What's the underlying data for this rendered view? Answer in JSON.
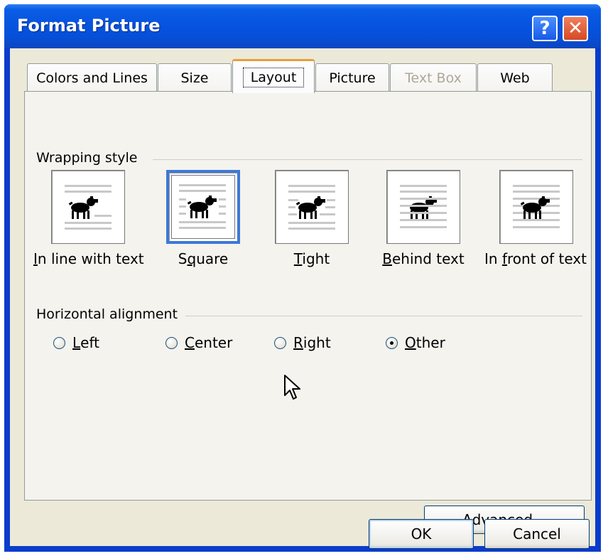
{
  "window": {
    "title": "Format Picture",
    "help_glyph": "?",
    "close_glyph": "✕",
    "accent_color": "#0a5ee6"
  },
  "tabs": [
    {
      "label": "Colors and Lines",
      "state": "normal"
    },
    {
      "label": "Size",
      "state": "normal"
    },
    {
      "label": "Layout",
      "state": "active"
    },
    {
      "label": "Picture",
      "state": "normal"
    },
    {
      "label": "Text Box",
      "state": "disabled"
    },
    {
      "label": "Web",
      "state": "normal"
    }
  ],
  "wrapping": {
    "group_label": "Wrapping style",
    "options": [
      {
        "label_pre": "",
        "label_u": "I",
        "label_post": "n line with text",
        "icon": "inline-wrap-icon"
      },
      {
        "label_pre": "S",
        "label_u": "q",
        "label_post": "uare",
        "icon": "square-wrap-icon",
        "selected": true
      },
      {
        "label_pre": "",
        "label_u": "T",
        "label_post": "ight",
        "icon": "tight-wrap-icon"
      },
      {
        "label_pre": "",
        "label_u": "B",
        "label_post": "ehind text",
        "icon": "behind-text-icon"
      },
      {
        "label_pre": "In ",
        "label_u": "f",
        "label_post": "ront of text",
        "icon": "in-front-icon"
      }
    ]
  },
  "alignment": {
    "group_label": "Horizontal alignment",
    "options": [
      {
        "label_u": "L",
        "label_post": "eft",
        "checked": false
      },
      {
        "label_u": "C",
        "label_post": "enter",
        "checked": false
      },
      {
        "label_u": "R",
        "label_post": "ight",
        "checked": false
      },
      {
        "label_u": "O",
        "label_post": "ther",
        "checked": true
      }
    ]
  },
  "buttons": {
    "advanced_u": "A",
    "advanced_post": "dvanced...",
    "ok": "OK",
    "cancel": "Cancel"
  }
}
